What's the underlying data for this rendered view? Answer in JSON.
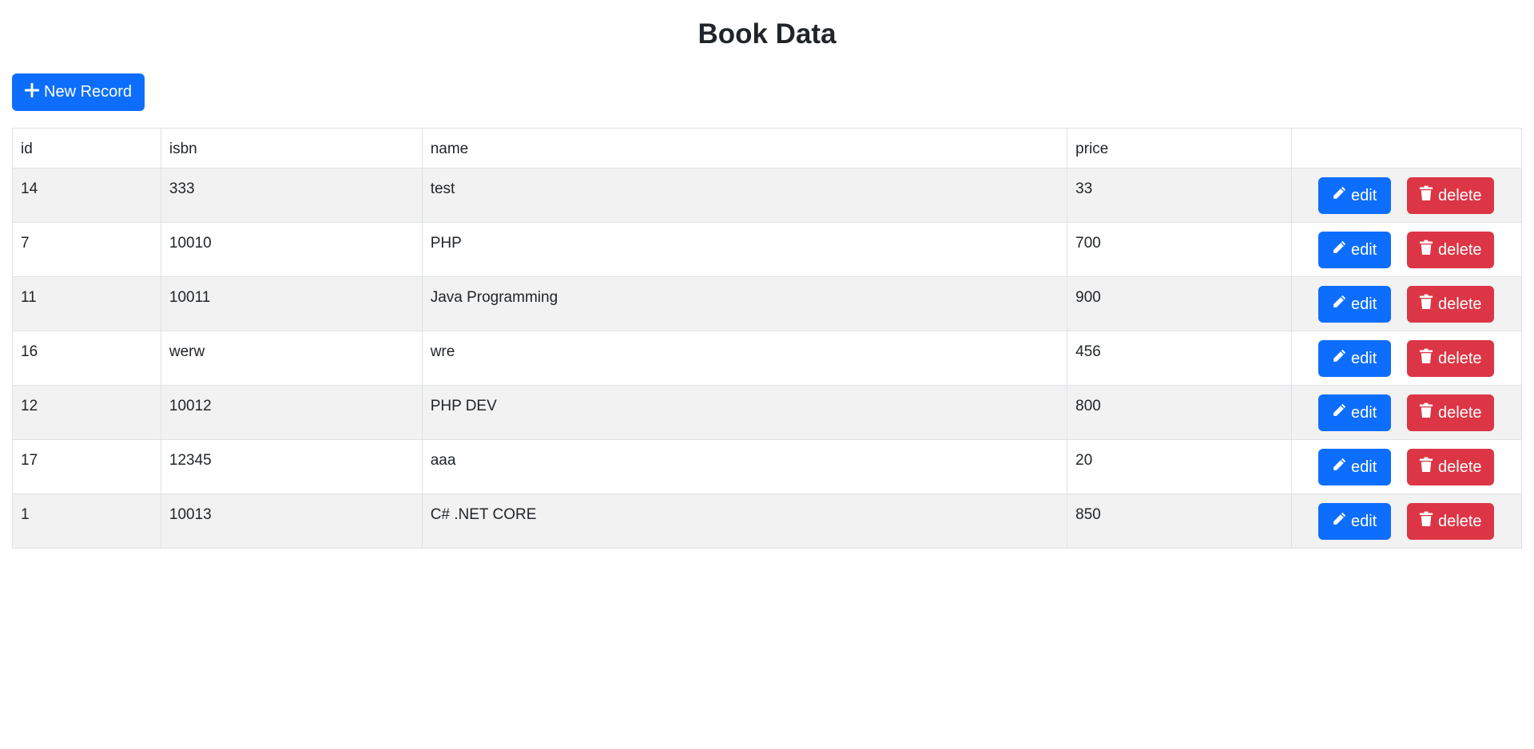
{
  "page": {
    "title": "Book Data"
  },
  "toolbar": {
    "new_record_label": "New Record",
    "new_record_icon": "plus-icon"
  },
  "table": {
    "columns": [
      "id",
      "isbn",
      "name",
      "price",
      ""
    ],
    "rows": [
      {
        "id": "14",
        "isbn": "333",
        "name": "test",
        "price": "33"
      },
      {
        "id": "7",
        "isbn": "10010",
        "name": "PHP",
        "price": "700"
      },
      {
        "id": "11",
        "isbn": "10011",
        "name": "Java Programming",
        "price": "900"
      },
      {
        "id": "16",
        "isbn": "werw",
        "name": "wre",
        "price": "456"
      },
      {
        "id": "12",
        "isbn": "10012",
        "name": "PHP DEV",
        "price": "800"
      },
      {
        "id": "17",
        "isbn": "12345",
        "name": "aaa",
        "price": "20"
      },
      {
        "id": "1",
        "isbn": "10013",
        "name": "C# .NET CORE",
        "price": "850"
      }
    ],
    "edit_label": "edit",
    "edit_icon": "pencil-icon",
    "delete_label": "delete",
    "delete_icon": "trash-icon"
  },
  "colors": {
    "primary": "#0d6efd",
    "danger": "#dc3545",
    "stripe": "#f2f2f2",
    "border": "#dee2e6"
  }
}
